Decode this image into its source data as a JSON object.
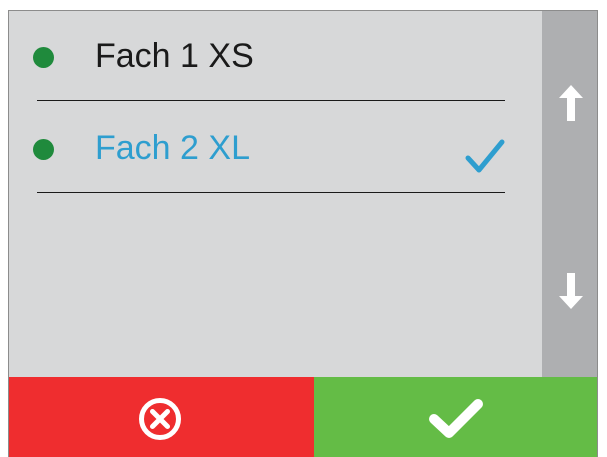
{
  "list": {
    "items": [
      {
        "label": "Fach 1 XS",
        "status_color": "#1f8a3c",
        "selected": false
      },
      {
        "label": "Fach 2 XL",
        "status_color": "#1f8a3c",
        "selected": true
      }
    ],
    "selected_color": "#2e9ecf"
  },
  "scrollbar": {
    "up_icon": "arrow-up-icon",
    "down_icon": "arrow-down-icon"
  },
  "footer": {
    "cancel": {
      "icon": "cancel-circle-x-icon",
      "color": "#ef2d2f"
    },
    "confirm": {
      "icon": "checkmark-icon",
      "color": "#64bc46"
    }
  },
  "colors": {
    "panel_bg": "#d7d8d9",
    "scrollbar_bg": "#aeafb1"
  }
}
